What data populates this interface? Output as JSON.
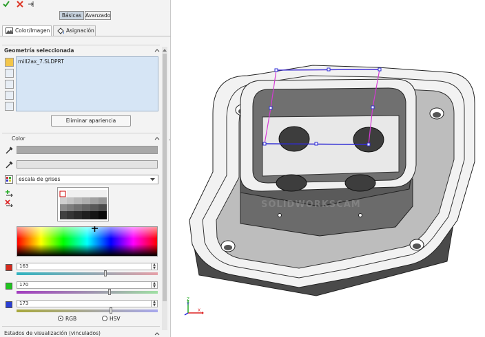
{
  "toolbar": {
    "ok_icon": "checkmark-icon",
    "cancel_icon": "close-icon",
    "pin_icon": "pin-icon"
  },
  "mode_buttons": {
    "basic": "Básicas",
    "advanced": "Avanzado"
  },
  "tabs": {
    "color_image": "Color/Imagen",
    "assignment": "Asignación"
  },
  "geometry": {
    "title": "Geometría seleccionada",
    "selected_item": "mill2ax_7.SLDPRT"
  },
  "remove_button": "Eliminar apariencia",
  "color_section": {
    "title": "Color",
    "palette_dropdown": "escala de grises",
    "main_color": "#a8a8a8",
    "rgb": {
      "r": "163",
      "g": "170",
      "b": "173"
    },
    "r_fraction": 0.64,
    "g_fraction": 0.67,
    "b_fraction": 0.68,
    "radio_rgb": "RGB",
    "radio_hsv": "HSV",
    "selected_model": "RGB"
  },
  "display_states": {
    "title": "Estados de visualización (vinculados)"
  },
  "viewport": {
    "watermark": "SOLIDWORKSCAM",
    "triad": {
      "x": "X",
      "y": "Y",
      "z": "Z"
    }
  }
}
